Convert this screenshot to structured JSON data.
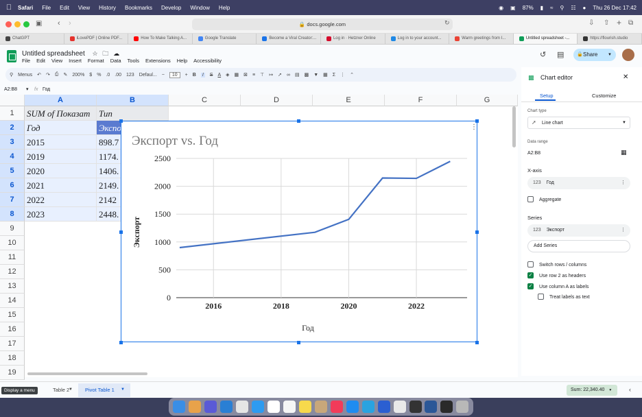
{
  "menubar": {
    "app": "Safari",
    "items": [
      "File",
      "Edit",
      "View",
      "History",
      "Bookmarks",
      "Develop",
      "Window",
      "Help"
    ],
    "battery": "87%",
    "datetime": "Thu 26 Dec  17:42"
  },
  "browser": {
    "url": "docs.google.com",
    "tabs": [
      {
        "label": "ChatGPT",
        "color": "#444444"
      },
      {
        "label": "iLovePDF | Online PDF...",
        "color": "#e5322d"
      },
      {
        "label": "How To Make Talking A...",
        "color": "#ff0000"
      },
      {
        "label": "Google Translate",
        "color": "#4285f4"
      },
      {
        "label": "Become a Viral Creator:...",
        "color": "#1a73e8"
      },
      {
        "label": "Log in · Hetzner Online",
        "color": "#d50c2d"
      },
      {
        "label": "Log in to your account...",
        "color": "#1e88e5"
      },
      {
        "label": "Warm greetings from I...",
        "color": "#ea4335"
      },
      {
        "label": "Untitled spreadsheet -...",
        "color": "#0f9d58"
      },
      {
        "label": "https://flourish.studio",
        "color": "#333333"
      }
    ]
  },
  "sheets": {
    "title": "Untitled spreadsheet",
    "menu": [
      "File",
      "Edit",
      "View",
      "Insert",
      "Format",
      "Data",
      "Tools",
      "Extensions",
      "Help",
      "Accessibility"
    ],
    "share_label": "Share",
    "toolbar": {
      "menus": "Menus",
      "zoom": "200%",
      "currency": "$",
      "percent": "%",
      "dec_less": ".0",
      "dec_more": ".00",
      "numfmt": "123",
      "font": "Defaul...",
      "font_size": "10"
    },
    "name_box": "A2:B8",
    "formula": "Год"
  },
  "grid": {
    "columns": [
      "A",
      "B",
      "C",
      "D",
      "E",
      "F",
      "G"
    ],
    "rows": [
      "1",
      "2",
      "3",
      "4",
      "5",
      "6",
      "7",
      "8",
      "9",
      "10",
      "11",
      "12",
      "13",
      "14",
      "15",
      "16",
      "17",
      "18",
      "19"
    ],
    "cells": {
      "a1": "SUM of Показат",
      "b1": "Тип",
      "a2": "Год",
      "b2": "Экспо",
      "a3": "2015",
      "b3": "898.7",
      "a4": "2019",
      "b4": "1174.",
      "a5": "2020",
      "b5": "1406.",
      "a6": "2021",
      "b6": "2149.",
      "a7": "2022",
      "b7": "2142",
      "a8": "2023",
      "b8": "2448."
    }
  },
  "chart_data": {
    "type": "line",
    "title": "Экспорт vs. Год",
    "xlabel": "Год",
    "ylabel": "Экспорт",
    "x": [
      2015,
      2019,
      2020,
      2021,
      2022,
      2023
    ],
    "series": [
      {
        "name": "Экспорт",
        "values": [
          898.7,
          1174,
          1406,
          2149,
          2142,
          2448
        ],
        "color": "#4472c4"
      }
    ],
    "xlim": [
      2014.9,
      2023.5
    ],
    "ylim": [
      0,
      2500
    ],
    "xticks": [
      "2016",
      "2018",
      "2020",
      "2022"
    ],
    "yticks": [
      "0",
      "500",
      "1000",
      "1500",
      "2000",
      "2500"
    ],
    "grid": true
  },
  "editor": {
    "title": "Chart editor",
    "tab_setup": "Setup",
    "tab_customize": "Customize",
    "chart_type_label": "Chart type",
    "chart_type_value": "Line chart",
    "data_range_label": "Data range",
    "data_range_value": "A2:B8",
    "xaxis_label": "X-axis",
    "xaxis_value": "Год",
    "aggregate": "Aggregate",
    "series_label": "Series",
    "series_value": "Экспорт",
    "add_series": "Add Series",
    "switch_rows": "Switch rows / columns",
    "use_row2": "Use row 2 as headers",
    "use_colA": "Use column A as labels",
    "treat_labels": "Treat labels as text",
    "numfmt": "123"
  },
  "footer": {
    "tooltip": "Display a menu",
    "sheet_tab1": "Table 2",
    "sheet_tab2": "Pivot Table 1",
    "sum": "Sum: 22,340.40"
  }
}
